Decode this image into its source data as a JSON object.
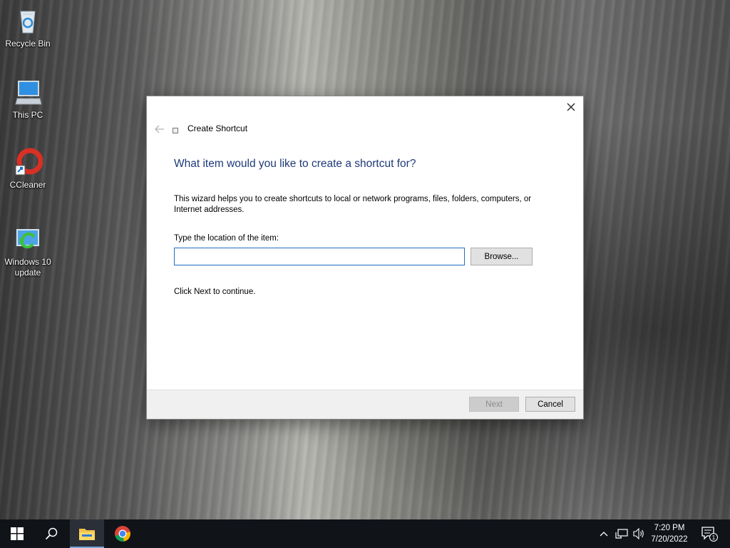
{
  "desktop": {
    "icons": [
      {
        "label": "Recycle Bin",
        "icon": "recycle-bin-icon"
      },
      {
        "label": "This PC",
        "icon": "computer-icon"
      },
      {
        "label": "CCleaner",
        "icon": "ccleaner-icon"
      },
      {
        "label": "Windows 10 update",
        "icon": "windows-update-icon"
      }
    ]
  },
  "dialog": {
    "title": "Create Shortcut",
    "heading": "What item would you like to create a shortcut for?",
    "description": "This wizard helps you to create shortcuts to local or network programs, files, folders, computers, or Internet addresses.",
    "location_label": "Type the location of the item:",
    "location_value": "",
    "browse_label": "Browse...",
    "instruction": "Click Next to continue.",
    "next_label": "Next",
    "cancel_label": "Cancel"
  },
  "taskbar": {
    "pinned": [
      "start-icon",
      "search-icon",
      "file-explorer-icon",
      "chrome-icon"
    ],
    "clock_time": "7:20 PM",
    "clock_date": "7/20/2022",
    "notification_count": "1"
  },
  "colors": {
    "heading": "#1e3a78",
    "input_border": "#1f6fc3",
    "taskbar": "#101318"
  }
}
